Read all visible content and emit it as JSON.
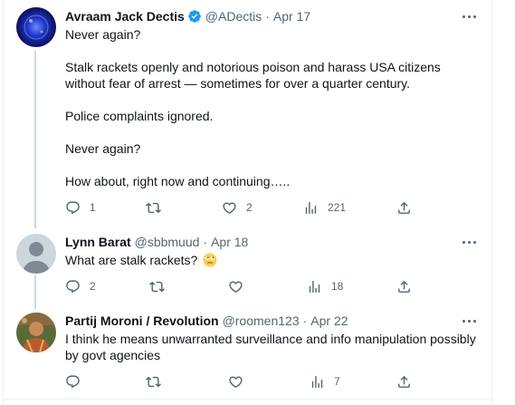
{
  "tweets": [
    {
      "name": "Avraam Jack Dectis",
      "handle": "@ADectis",
      "date": "Apr 17",
      "verified": true,
      "text": [
        "Never again?",
        "Stalk rackets openly and notorious poison and harass USA citizens without fear of arrest — sometimes for over a quarter century.",
        "Police complaints ignored.",
        "Never again?",
        "How about, right now and continuing….."
      ],
      "stats": {
        "replies": "1",
        "retweets": "",
        "likes": "2",
        "views": "221"
      }
    },
    {
      "name": "Lynn Barat",
      "handle": "@sbbmuud",
      "date": "Apr 18",
      "text": "What are stalk rackets?",
      "emoji": "face-with-rolling-eyes",
      "stats": {
        "replies": "2",
        "retweets": "",
        "likes": "",
        "views": "18"
      }
    },
    {
      "name": "Partij Moroni / Revolution",
      "handle": "@roomen123",
      "date": "Apr 22",
      "text": "I think he means unwarranted surveillance and info manipulation possibly by govt agencies",
      "stats": {
        "replies": "",
        "retweets": "",
        "likes": "",
        "views": "7"
      }
    }
  ],
  "icons": {
    "reply": "reply-icon",
    "retweet": "retweet-icon",
    "like": "heart-icon",
    "views": "views-icon",
    "share": "share-icon",
    "more": "more-icon",
    "verified": "verified-badge-icon"
  },
  "colors": {
    "text": "#0f1419",
    "secondary": "#536471",
    "verified": "#1d9bf0",
    "thread_line": "#cfd9de"
  }
}
